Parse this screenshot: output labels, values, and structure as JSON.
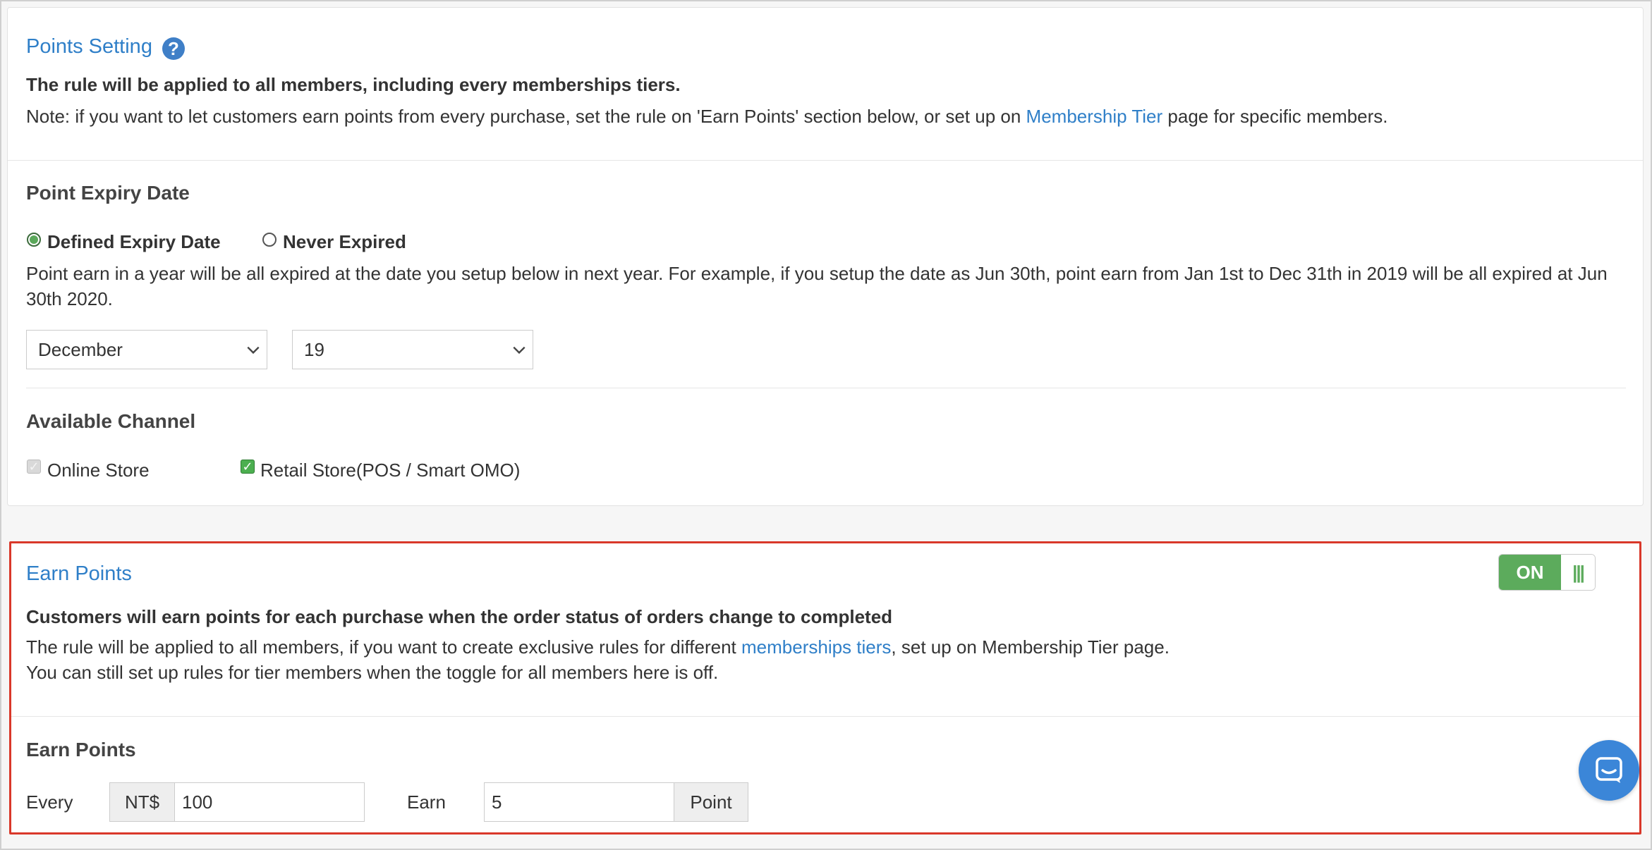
{
  "points_setting": {
    "title": "Points Setting",
    "help_glyph": "?",
    "rule_bold": "The rule will be applied to all members, including every memberships tiers.",
    "note_prefix": "Note: if you want to let customers earn points from every purchase, set the rule on 'Earn Points' section below, or set up on ",
    "note_link": "Membership Tier",
    "note_suffix": " page for specific members."
  },
  "expiry": {
    "heading": "Point Expiry Date",
    "radio_defined": "Defined Expiry Date",
    "radio_never": "Never Expired",
    "selected": "Defined Expiry Date",
    "description": "Point earn in a year will be all expired at the date you setup below in next year. For example, if you setup the date as Jun 30th, point earn from Jan 1st to Dec 31th in 2019 will be all expired at Jun 30th 2020.",
    "month_value": "December",
    "day_value": "19"
  },
  "channel": {
    "heading": "Available Channel",
    "online_label": "Online Store",
    "online_checked": true,
    "retail_label": "Retail Store(POS / Smart OMO)",
    "retail_checked": true
  },
  "earn_points": {
    "title": "Earn Points",
    "toggle_label": "ON",
    "toggle_handle": "|||",
    "bold_line": "Customers will earn points for each purchase when the order status of orders change to completed",
    "line1_prefix": "The rule will be applied to all members, if you want to create exclusive rules for different ",
    "line1_link": "memberships tiers",
    "line1_suffix": ", set up on Membership Tier page.",
    "line2": "You can still set up rules for tier members when the toggle for all members here is off.",
    "sub_heading": "Earn Points",
    "every_label": "Every",
    "currency": "NT$",
    "amount": "100",
    "earn_label": "Earn",
    "points_value": "5",
    "points_unit": "Point"
  },
  "colors": {
    "link": "#2f7fc8",
    "toggle_on": "#5cab5c",
    "highlight_border": "#d9382a"
  },
  "icons": {
    "help": "question-circle-icon",
    "chat": "chat-bubble-icon",
    "chevron": "chevron-down-icon"
  }
}
